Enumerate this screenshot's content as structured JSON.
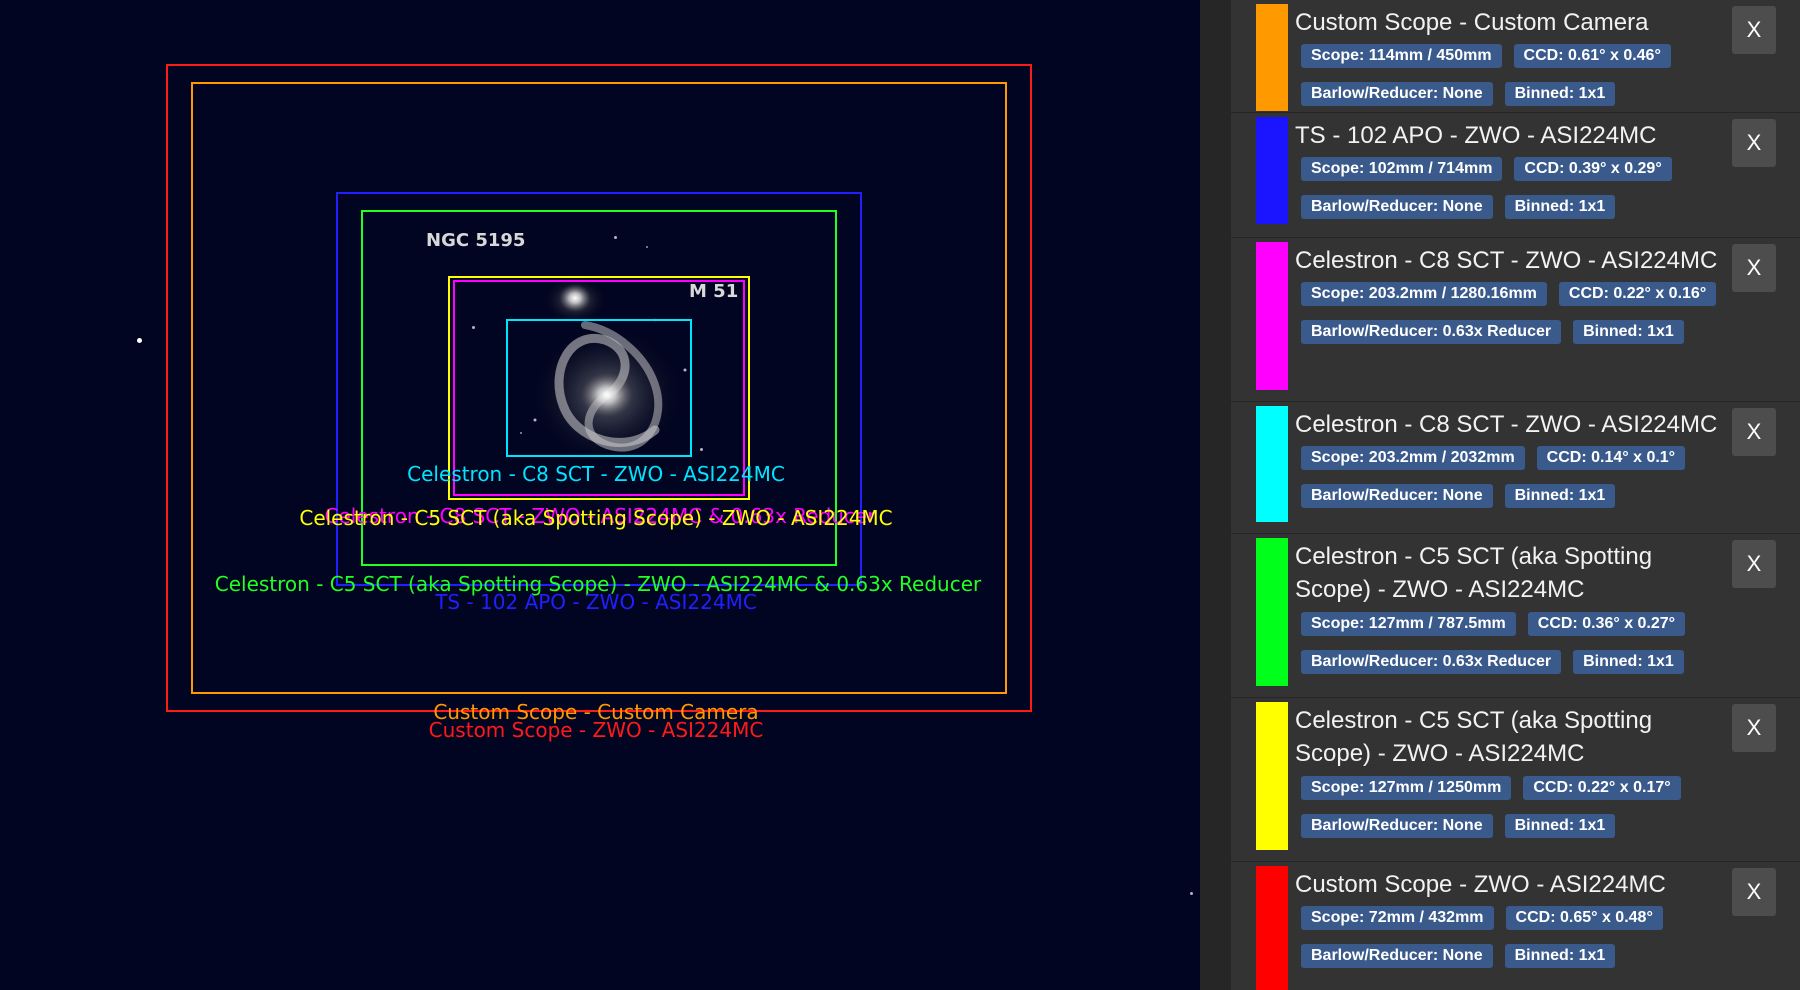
{
  "sky": {
    "objects": [
      {
        "label": "NGC 5195"
      },
      {
        "label": "M 51"
      }
    ],
    "fov_labels": [
      {
        "text": "Celestron - C8 SCT - ZWO - ASI224MC",
        "color": "#00e5ff"
      },
      {
        "text": "Celestron - C8 SCT - ZWO - ASI224MC  & 0.63x Reducer",
        "color": "#ff00ff"
      },
      {
        "text": "Celestron - C5 SCT (aka Spotting Scope) - ZWO - ASI224MC",
        "color": "#ffff00"
      },
      {
        "text": "Celestron - C5 SCT (aka Spotting Scope) - ZWO - ASI224MC  & 0.63x Reducer",
        "color": "#22ff22"
      },
      {
        "text": "TS - 102 APO - ZWO - ASI224MC",
        "color": "#2020ff"
      },
      {
        "text": "Custom Scope - Custom Camera",
        "color": "#ff9900"
      },
      {
        "text": "Custom Scope - ZWO - ASI224MC",
        "color": "#ff1a1a"
      }
    ]
  },
  "panel": {
    "close_label": "X",
    "cards": [
      {
        "title": "Custom Scope - Custom Camera",
        "color": "#ff9900",
        "badges": [
          "Scope: 114mm / 450mm",
          "CCD: 0.61° x 0.46°",
          "Barlow/Reducer: None",
          "Binned: 1x1"
        ]
      },
      {
        "title": "TS - 102 APO - ZWO - ASI224MC",
        "color": "#1a14ff",
        "badges": [
          "Scope: 102mm / 714mm",
          "CCD: 0.39° x 0.29°",
          "Barlow/Reducer: None",
          "Binned: 1x1"
        ]
      },
      {
        "title": "Celestron - C8 SCT - ZWO - ASI224MC",
        "color": "#ff00ff",
        "badges": [
          "Scope: 203.2mm / 1280.16mm",
          "CCD: 0.22° x 0.16°",
          "Barlow/Reducer: 0.63x Reducer",
          "Binned: 1x1"
        ]
      },
      {
        "title": "Celestron - C8 SCT - ZWO - ASI224MC",
        "color": "#00ffff",
        "badges": [
          "Scope: 203.2mm / 2032mm",
          "CCD: 0.14° x 0.1°",
          "Barlow/Reducer: None",
          "Binned: 1x1"
        ]
      },
      {
        "title": "Celestron - C5 SCT (aka Spotting Scope) - ZWO - ASI224MC",
        "color": "#00ff1a",
        "badges": [
          "Scope: 127mm / 787.5mm",
          "CCD: 0.36° x 0.27°",
          "Barlow/Reducer: 0.63x Reducer",
          "Binned: 1x1"
        ]
      },
      {
        "title": "Celestron - C5 SCT (aka Spotting Scope) - ZWO - ASI224MC",
        "color": "#ffff00",
        "badges": [
          "Scope: 127mm / 1250mm",
          "CCD: 0.22° x 0.17°",
          "Barlow/Reducer: None",
          "Binned: 1x1"
        ]
      },
      {
        "title": "Custom Scope - ZWO - ASI224MC",
        "color": "#ff0000",
        "badges": [
          "Scope: 72mm / 432mm",
          "CCD: 0.65° x 0.48°",
          "Barlow/Reducer: None",
          "Binned: 1x1"
        ]
      }
    ]
  }
}
